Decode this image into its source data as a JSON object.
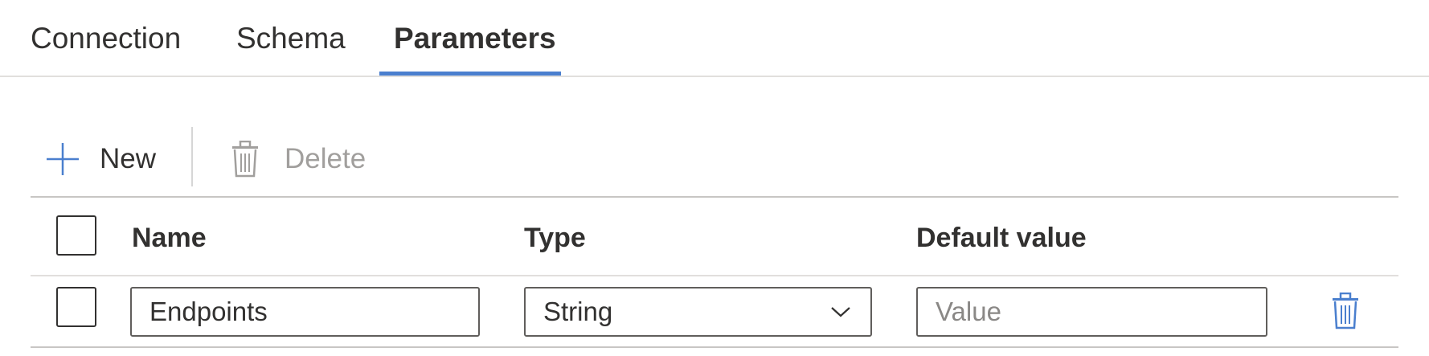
{
  "tabs": [
    {
      "label": "Connection",
      "active": false
    },
    {
      "label": "Schema",
      "active": false
    },
    {
      "label": "Parameters",
      "active": true
    }
  ],
  "toolbar": {
    "new_label": "New",
    "delete_label": "Delete",
    "delete_disabled": true
  },
  "table": {
    "columns": [
      "Name",
      "Type",
      "Default value"
    ],
    "rows": [
      {
        "name": "Endpoints",
        "type": "String",
        "default_value": "",
        "default_placeholder": "Value"
      }
    ]
  },
  "colors": {
    "accent": "#4a7fce",
    "text": "#323130",
    "disabled": "#a19f9d",
    "divider": "#e1dfdd"
  },
  "icons": [
    "plus-icon",
    "trash-icon",
    "chevron-down-icon"
  ]
}
